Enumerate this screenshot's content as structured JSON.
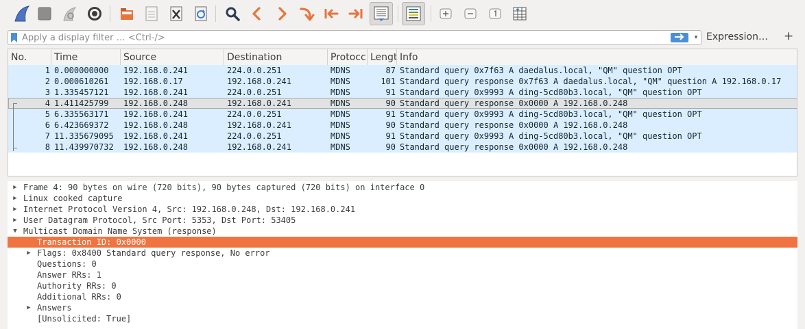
{
  "toolbar": {
    "buttons": [
      {
        "icon": "shark-fin-start-icon"
      },
      {
        "icon": "stop-icon"
      },
      {
        "icon": "restart-icon"
      },
      {
        "icon": "capture-options-gear-icon"
      },
      {
        "icon": "open-file-icon"
      },
      {
        "icon": "save-file-icon"
      },
      {
        "icon": "close-file-icon"
      },
      {
        "icon": "reload-file-icon"
      },
      {
        "icon": "find-packet-icon"
      },
      {
        "icon": "go-back-icon"
      },
      {
        "icon": "go-forward-icon"
      },
      {
        "icon": "go-to-packet-icon"
      },
      {
        "icon": "go-first-packet-icon"
      },
      {
        "icon": "go-last-packet-icon"
      },
      {
        "icon": "auto-scroll-icon"
      },
      {
        "icon": "colorize-icon"
      },
      {
        "icon": "zoom-in-icon"
      },
      {
        "icon": "zoom-out-icon"
      },
      {
        "icon": "normal-size-icon"
      },
      {
        "icon": "resize-columns-icon"
      }
    ]
  },
  "filter": {
    "placeholder": "Apply a display filter … <Ctrl-/>",
    "value": "",
    "expression_label": "Expression…",
    "add_label": "+"
  },
  "packet_list": {
    "columns": [
      "No.",
      "Time",
      "Source",
      "Destination",
      "Protocol",
      "Length",
      "Info"
    ],
    "header_display": [
      "No.",
      "Time",
      "Source",
      "Destination",
      "Protocc",
      "Lengt",
      "Info"
    ],
    "selected_row": 3,
    "rows": [
      {
        "no": "1",
        "time": "0.000000000",
        "source": "192.168.0.241",
        "destination": "224.0.0.251",
        "protocol": "MDNS",
        "length": "87",
        "info": "Standard query 0x7f63 A daedalus.local, \"QM\" question OPT"
      },
      {
        "no": "2",
        "time": "0.000610261",
        "source": "192.168.0.17",
        "destination": "192.168.0.241",
        "protocol": "MDNS",
        "length": "101",
        "info": "Standard query response 0x7f63 A daedalus.local, \"QM\" question A 192.168.0.17"
      },
      {
        "no": "3",
        "time": "1.335457121",
        "source": "192.168.0.241",
        "destination": "224.0.0.251",
        "protocol": "MDNS",
        "length": "91",
        "info": "Standard query 0x9993 A ding-5cd80b3.local, \"QM\" question OPT"
      },
      {
        "no": "4",
        "time": "1.411425799",
        "source": "192.168.0.248",
        "destination": "192.168.0.241",
        "protocol": "MDNS",
        "length": "90",
        "info": "Standard query response 0x0000 A 192.168.0.248"
      },
      {
        "no": "5",
        "time": "6.335563171",
        "source": "192.168.0.241",
        "destination": "224.0.0.251",
        "protocol": "MDNS",
        "length": "91",
        "info": "Standard query 0x9993 A ding-5cd80b3.local, \"QM\" question OPT"
      },
      {
        "no": "6",
        "time": "6.423669372",
        "source": "192.168.0.248",
        "destination": "192.168.0.241",
        "protocol": "MDNS",
        "length": "90",
        "info": "Standard query response 0x0000 A 192.168.0.248"
      },
      {
        "no": "7",
        "time": "11.335679095",
        "source": "192.168.0.241",
        "destination": "224.0.0.251",
        "protocol": "MDNS",
        "length": "91",
        "info": "Standard query 0x9993 A ding-5cd80b3.local, \"QM\" question OPT"
      },
      {
        "no": "8",
        "time": "11.439970732",
        "source": "192.168.0.248",
        "destination": "192.168.0.241",
        "protocol": "MDNS",
        "length": "90",
        "info": "Standard query response 0x0000 A 192.168.0.248"
      }
    ]
  },
  "details": {
    "rows": [
      {
        "text": "Frame 4: 90 bytes on wire (720 bits), 90 bytes captured (720 bits) on interface 0",
        "level": 0,
        "expander": "collapsed"
      },
      {
        "text": "Linux cooked capture",
        "level": 0,
        "expander": "collapsed"
      },
      {
        "text": "Internet Protocol Version 4, Src: 192.168.0.248, Dst: 192.168.0.241",
        "level": 0,
        "expander": "collapsed"
      },
      {
        "text": "User Datagram Protocol, Src Port: 5353, Dst Port: 53405",
        "level": 0,
        "expander": "collapsed"
      },
      {
        "text": "Multicast Domain Name System (response)",
        "level": 0,
        "expander": "expanded"
      },
      {
        "text": "Transaction ID: 0x0000",
        "level": 1,
        "expander": "none",
        "highlighted": true
      },
      {
        "text": "Flags: 0x8400 Standard query response, No error",
        "level": 1,
        "expander": "collapsed"
      },
      {
        "text": "Questions: 0",
        "level": 1,
        "expander": "none"
      },
      {
        "text": "Answer RRs: 1",
        "level": 1,
        "expander": "none"
      },
      {
        "text": "Authority RRs: 0",
        "level": 1,
        "expander": "none"
      },
      {
        "text": "Additional RRs: 0",
        "level": 1,
        "expander": "none"
      },
      {
        "text": "Answers",
        "level": 1,
        "expander": "collapsed"
      },
      {
        "text": "[Unsolicited: True]",
        "level": 1,
        "expander": "none"
      }
    ]
  },
  "colors": {
    "row_bg": "#daeeff",
    "selected_row_bg": "#e2e2e2",
    "highlight_bg": "#ef7441",
    "accent_blue": "#4a90d9"
  }
}
